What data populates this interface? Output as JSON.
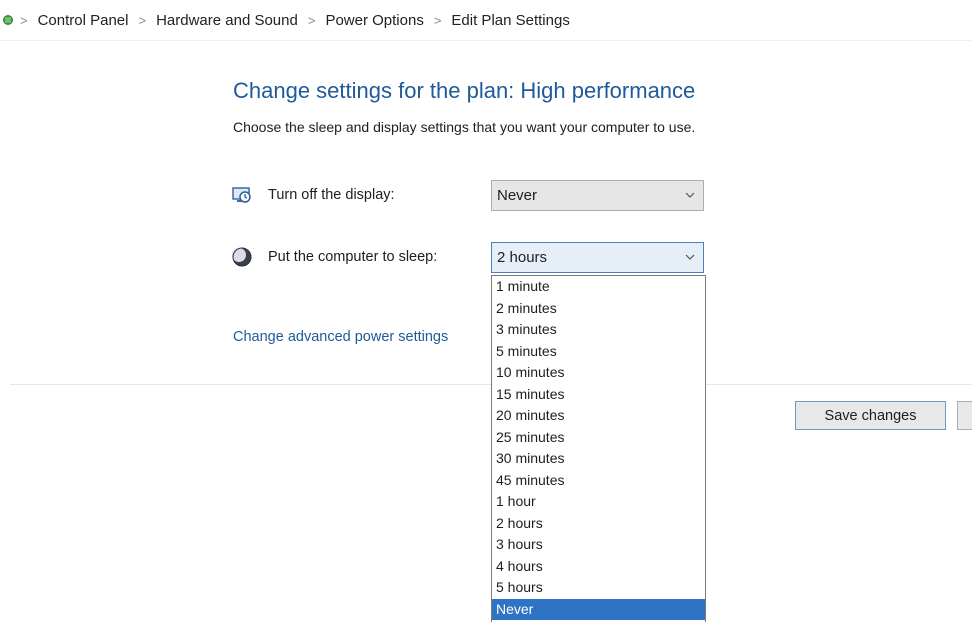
{
  "breadcrumb": {
    "items": [
      "Control Panel",
      "Hardware and Sound",
      "Power Options",
      "Edit Plan Settings"
    ],
    "separator": ">"
  },
  "page": {
    "title": "Change settings for the plan: High performance",
    "subtitle": "Choose the sleep and display settings that you want your computer to use."
  },
  "settings": {
    "display": {
      "label": "Turn off the display:",
      "value": "Never"
    },
    "sleep": {
      "label": "Put the computer to sleep:",
      "value": "2 hours",
      "options": [
        "1 minute",
        "2 minutes",
        "3 minutes",
        "5 minutes",
        "10 minutes",
        "15 minutes",
        "20 minutes",
        "25 minutes",
        "30 minutes",
        "45 minutes",
        "1 hour",
        "2 hours",
        "3 hours",
        "4 hours",
        "5 hours",
        "Never"
      ],
      "highlighted_option": "Never"
    }
  },
  "links": {
    "advanced": "Change advanced power settings"
  },
  "buttons": {
    "save": "Save changes",
    "cancel": ""
  },
  "colors": {
    "link": "#1f5a9b",
    "highlight": "#2f74c4"
  }
}
